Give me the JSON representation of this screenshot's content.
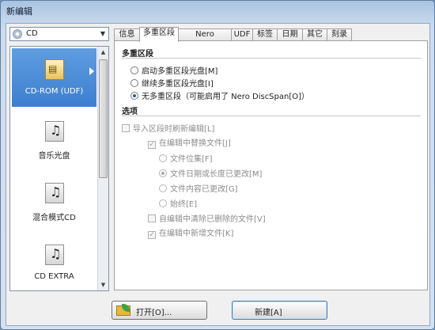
{
  "window": {
    "title": "新编辑"
  },
  "disc_selector": {
    "value": "CD",
    "icon": "disc-icon"
  },
  "disc_types": [
    {
      "label": "CD-ROM (UDF)",
      "icon": "cdrom-disc-icon",
      "selected": true
    },
    {
      "label": "音乐光盘",
      "icon": "music-disc-icon",
      "selected": false
    },
    {
      "label": "混合模式CD",
      "icon": "mixed-mode-disc-icon",
      "selected": false
    },
    {
      "label": "CD EXTRA",
      "icon": "cd-extra-disc-icon",
      "selected": false
    }
  ],
  "tabs": [
    {
      "label": "信息",
      "active": false
    },
    {
      "label": "多重区段",
      "active": true
    },
    {
      "label": "Nero DiscSpan",
      "active": false
    },
    {
      "label": "UDF",
      "active": false
    },
    {
      "label": "标签",
      "active": false
    },
    {
      "label": "日期",
      "active": false
    },
    {
      "label": "其它",
      "active": false
    },
    {
      "label": "刻录",
      "active": false
    }
  ],
  "multisession": {
    "heading": "多重区段",
    "options": [
      {
        "label": "启动多重区段光盘[M]",
        "selected": false
      },
      {
        "label": "继续多重区段光盘[I]",
        "selected": false
      },
      {
        "label": "无多重区段（可能启用了 Nero DiscSpan[O]）",
        "selected": true
      }
    ]
  },
  "options": {
    "heading": "选项",
    "import_refresh": "导入区段时刷新编辑[L]",
    "replace_files": "在编辑中替换文件[J]",
    "replace_modes": [
      {
        "label": "文件位集[F]",
        "selected": false
      },
      {
        "label": "文件日期或长度已更改[M]",
        "selected": true
      },
      {
        "label": "文件内容已更改[G]",
        "selected": false
      },
      {
        "label": "始终[E]",
        "selected": false
      }
    ],
    "remove_deleted": "自编辑中清除已删除的文件[V]",
    "mark_new": "在编辑中新增文件[K]"
  },
  "buttons": {
    "open": "打开[O]...",
    "new": "新建[A]"
  }
}
